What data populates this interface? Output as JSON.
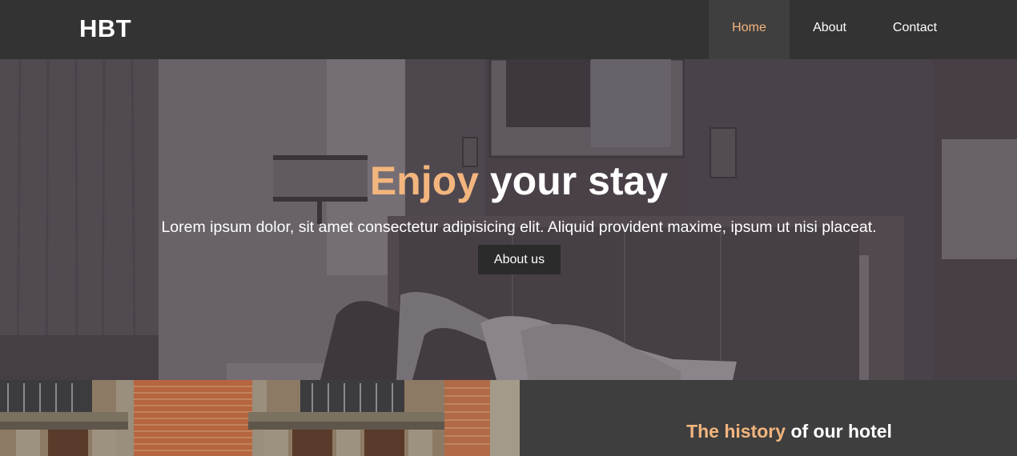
{
  "header": {
    "logo": "HBT",
    "nav": [
      {
        "label": "Home",
        "active": true
      },
      {
        "label": "About",
        "active": false
      },
      {
        "label": "Contact",
        "active": false
      }
    ]
  },
  "hero": {
    "title_accent": "Enjoy",
    "title_rest": "your stay",
    "text": "Lorem ipsum dolor, sit amet consectetur adipisicing elit. Aliquid provident maxime, ipsum ut nisi placeat.",
    "button_label": "About us"
  },
  "history": {
    "title_accent": "The history",
    "title_rest": "of our hotel"
  },
  "colors": {
    "accent": "#f3b57e",
    "header_bg": "#333333",
    "nav_active_bg": "#3f3f3f",
    "panel_bg": "#3e3e3e",
    "button_bg": "#2b2b2b"
  }
}
